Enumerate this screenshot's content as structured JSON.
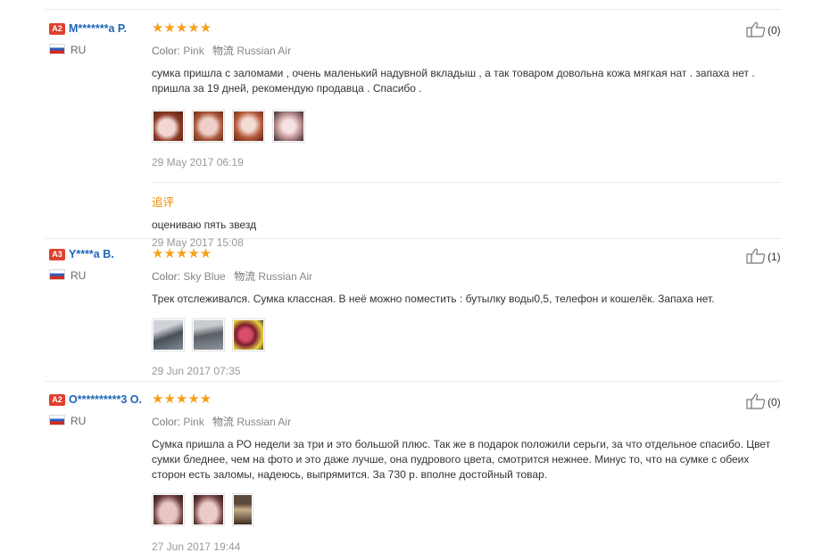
{
  "labels": {
    "color": "Color:",
    "shipping": "物流"
  },
  "feedbacks": [
    {
      "level": "A2",
      "name": "M*******a P.",
      "country": "RU",
      "rating": "★★★★★",
      "color": "Pink",
      "shipping": "Russian Air",
      "text": "сумка пришла с заломами , очень маленький надувной вкладыш , а так товаром довольна кожа мягкая нат . запаха нет . пришла за 19 дней, рекомендую продавца . Спасибо .",
      "date": "29 May 2017 06:19",
      "helpful": "(0)",
      "append_label": "追评",
      "append_text": "оцениваю пять звезд",
      "append_date": "29 May 2017 15:08"
    },
    {
      "level": "A3",
      "name": "Y****a B.",
      "country": "RU",
      "rating": "★★★★★",
      "color": "Sky Blue",
      "shipping": "Russian Air",
      "text": "Трек отслеживался. Сумка классная. В неё можно поместить : бутылку воды0,5, телефон и кошелёк. Запаха нет.",
      "date": "29 Jun 2017 07:35",
      "helpful": "(1)"
    },
    {
      "level": "A2",
      "name": "O**********3 O.",
      "country": "RU",
      "rating": "★★★★★",
      "color": "Pink",
      "shipping": "Russian Air",
      "text": "Сумка пришла а РО недели за три и это большой плюс. Так же в подарок положили серьги, за что отдельное спасибо. Цвет сумки бледнее, чем на фото и это даже лучше, она пудрового цвета, смотрится нежнее. Минус то, что на сумке с обеих сторон есть заломы, надеюсь, выпрямится. За 730 р. вполне достойный товар.",
      "date": "27 Jun 2017 19:44",
      "helpful": "(0)"
    }
  ],
  "colors": {
    "accent_name": "#1f66b8",
    "badge": "#e0402f",
    "stars": "#f6a11c",
    "append_label": "#f08b00"
  },
  "icons": {
    "helpful": "thumbs-up-icon",
    "flag": "russia-flag-icon"
  }
}
